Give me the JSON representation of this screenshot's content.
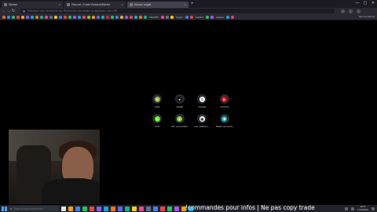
{
  "tabs": [
    {
      "label": "Stream",
      "active": false
    },
    {
      "label": "Discord | Trade Workers/Bitmex",
      "active": false
    },
    {
      "label": "Nouvel onglet",
      "active": true
    }
  ],
  "window_controls": {
    "minimize": "—",
    "maximize": "▢",
    "close": "✕"
  },
  "nav": {
    "back": "←",
    "forward": "→",
    "reload": "↻"
  },
  "addressbar": {
    "placeholder": "Effectuez une recherche sur Recherche sécurisée ou saisissez une URL"
  },
  "bookmarks": {
    "items": [
      {
        "color": "#e2711d"
      },
      {
        "color": "#3b82f6"
      },
      {
        "color": "#22c55e"
      },
      {
        "color": "#ef4444"
      },
      {
        "color": "#eab308"
      },
      {
        "color": "#8b5cf6"
      },
      {
        "color": "#06b6d4"
      },
      {
        "color": "#f97316"
      },
      {
        "color": "#10b981"
      },
      {
        "color": "#ec4899"
      },
      {
        "color": "#64748b"
      },
      {
        "color": "#facc15"
      },
      {
        "color": "#3b82f6"
      },
      {
        "color": "#ef4444"
      },
      {
        "color": "#22c55e"
      },
      {
        "color": "#a855f7"
      },
      {
        "color": "#0ea5e9"
      },
      {
        "color": "#f43f5e"
      },
      {
        "color": "#84cc16"
      },
      {
        "color": "#f59e0b"
      },
      {
        "color": "#6366f1"
      },
      {
        "color": "#14b8a6"
      },
      {
        "color": "#e11d48"
      },
      {
        "color": "#22c55e"
      },
      {
        "color": "#3b82f6"
      },
      {
        "color": "#eab308"
      },
      {
        "color": "#8b5cf6"
      },
      {
        "color": "#ef4444"
      },
      {
        "color": "#06b6d4"
      },
      {
        "color": "#f97316"
      },
      {
        "color": "#10b981"
      },
      {
        "color": "#ec4899"
      },
      {
        "color": "#64748b"
      },
      {
        "color": "#facc15"
      },
      {
        "color": "#3b82f6"
      },
      {
        "color": "#ef4444"
      },
      {
        "color": "#22c55e"
      },
      {
        "color": "#a855f7"
      },
      {
        "color": "#0ea5e9"
      },
      {
        "color": "#f43f5e"
      }
    ],
    "texts": [
      "CRO BO",
      "Crypto",
      "CLMKA",
      "Ableton"
    ],
    "all_bookmarks": "Tous les favoris"
  },
  "shortcuts": [
    {
      "name": "Kalk",
      "glyph": "K",
      "color": "#8fbf3a"
    },
    {
      "name": "Aaaah",
      "glyph": "●",
      "color": "#111111"
    },
    {
      "name": "Google",
      "glyph": "G",
      "color": "#ffffff"
    },
    {
      "name": "YouTube",
      "glyph": "▶",
      "color": "#ff0000"
    },
    {
      "name": "Kick",
      "glyph": "K",
      "color": "#53fc18"
    },
    {
      "name": "Sni' reconnaitre",
      "glyph": "♥",
      "color": "#7bd13d"
    },
    {
      "name": "Les meilleurs...",
      "glyph": "▣",
      "color": "#f2f2f2"
    },
    {
      "name": "Radio rencontre",
      "glyph": "✱",
      "color": "#19b5a6"
    }
  ],
  "taskbar": {
    "search_placeholder": "Taper ici pour rechercher",
    "search_glyph": "⌕",
    "overlay_text": "!commandes pour infos | Ne pas copy trade",
    "icons": [
      {
        "color": "#e5e7eb"
      },
      {
        "color": "#f59e0b"
      },
      {
        "color": "#3b82f6"
      },
      {
        "color": "#22c55e"
      },
      {
        "color": "#ef4444"
      },
      {
        "color": "#8b5cf6"
      },
      {
        "color": "#0ea5e9"
      },
      {
        "color": "#f97316"
      },
      {
        "color": "#6366f1"
      },
      {
        "color": "#10b981"
      },
      {
        "color": "#facc15"
      },
      {
        "color": "#ec4899"
      },
      {
        "color": "#64748b"
      },
      {
        "color": "#3b82f6"
      },
      {
        "color": "#ef4444"
      },
      {
        "color": "#22c55e"
      },
      {
        "color": "#a855f7"
      },
      {
        "color": "#f59e0b"
      },
      {
        "color": "#0ea5e9"
      }
    ],
    "time": "23:1?",
    "date": "17/01/2024"
  }
}
